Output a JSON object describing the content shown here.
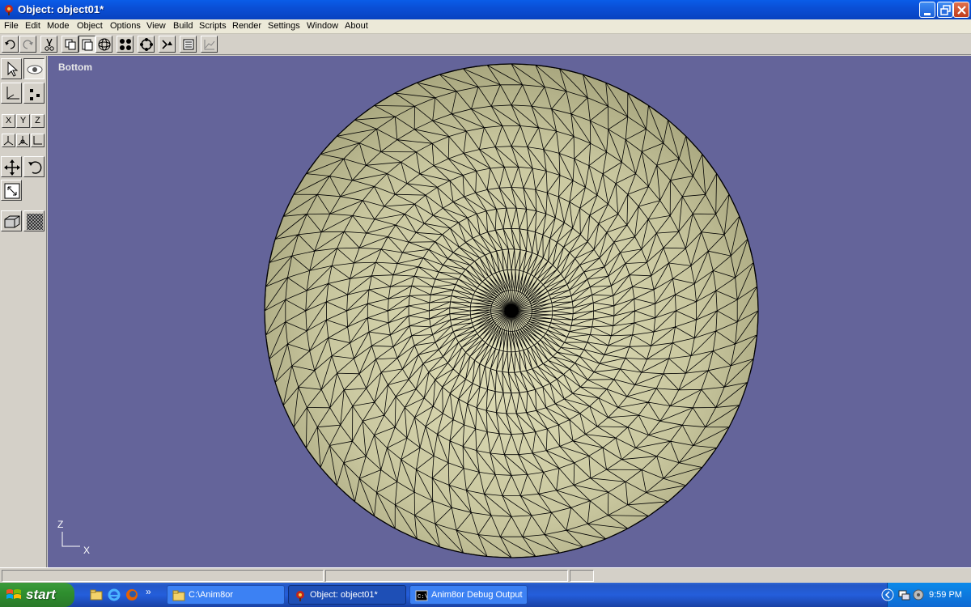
{
  "window": {
    "title": "Object: object01*",
    "app_icon": "anim8or-icon",
    "controls": [
      "minimize-icon",
      "maximize-icon",
      "close-icon"
    ]
  },
  "menu": [
    "File",
    "Edit",
    "Mode",
    "Object",
    "Options",
    "View",
    "Build",
    "Scripts",
    "Render",
    "Settings",
    "Window",
    "About"
  ],
  "toolbar": {
    "buttons": [
      "undo-icon",
      "redo-icon",
      "cut-icon",
      "copy-icon",
      "paste-icon",
      "sphere-icon",
      "points-icon",
      "rotate-select-icon",
      "transform-icon",
      "list-icon",
      "graph-icon"
    ]
  },
  "palette": {
    "axis_buttons": [
      "X",
      "Y",
      "Z"
    ],
    "tools": [
      "select-arrow-icon",
      "eye-icon",
      "axes-icon",
      "dots-icon",
      "move-icon",
      "rotate-icon",
      "scale-icon",
      "wireframe-icon",
      "texture-icon"
    ]
  },
  "viewport": {
    "view_name": "Bottom",
    "axis_vertical": "Z",
    "axis_horizontal": "X",
    "background_color": "#64649a",
    "mesh_fill_color": "#c8c69e"
  },
  "taskbar": {
    "start_label": "start",
    "quick_launch": [
      "explorer-icon",
      "ie-icon",
      "firefox-icon"
    ],
    "overflow": "»",
    "items": [
      {
        "label": "C:\\Anim8or",
        "icon": "folder-icon",
        "active": false
      },
      {
        "label": "Object: object01*",
        "icon": "anim8or-icon",
        "active": true
      },
      {
        "label": "Anim8or Debug Output",
        "icon": "console-icon",
        "active": false
      }
    ],
    "tray": {
      "clock": "9:59 PM"
    }
  }
}
